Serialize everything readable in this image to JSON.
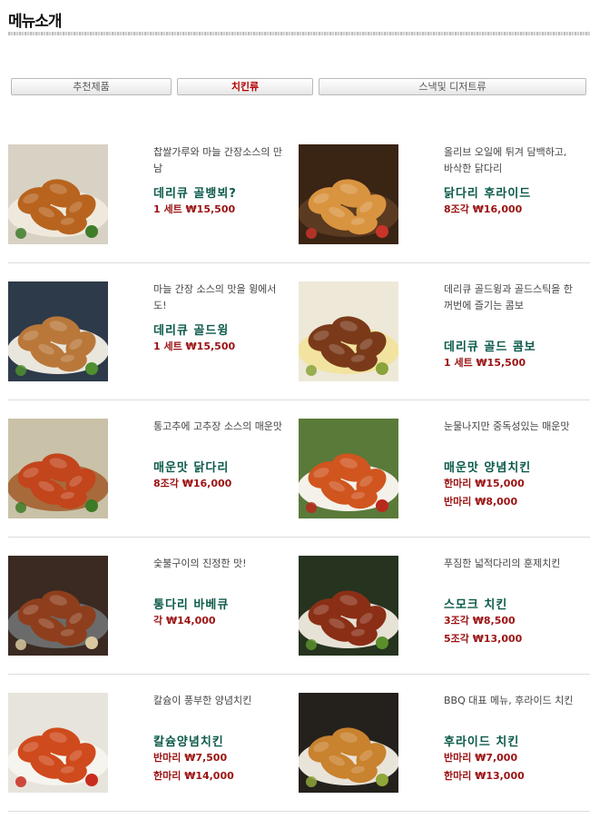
{
  "page": {
    "title": "메뉴소개"
  },
  "tabs": [
    {
      "label": "추천제품"
    },
    {
      "label": "치킨류"
    },
    {
      "label": "스낵및 디저트류"
    }
  ],
  "menu": [
    {
      "desc": "찹쌀가루와 마늘 간장소스의 만남",
      "name": "데리큐 골뱅뵈?",
      "prices": [
        "1 세트 ₩15,500"
      ]
    },
    {
      "desc": "올리브 오일에 튀겨 담백하고, 바삭한 닭다리",
      "name": "닭다리 후라이드",
      "prices": [
        "8조각 ₩16,000"
      ]
    },
    {
      "desc": "마늘 간장 소스의 맛을 윙에서도!",
      "name": "데리큐 골드윙",
      "prices": [
        "1 세트 ₩15,500"
      ]
    },
    {
      "desc": "데리큐 골드윙과 골드스틱을 한꺼번에 즐기는 콤보",
      "name": "데리큐 골드 콤보",
      "prices": [
        "1 세트 ₩15,500"
      ]
    },
    {
      "desc": "통고추에 고추장 소스의 매운맛",
      "name": "매운맛 닭다리",
      "prices": [
        "8조각 ₩16,000"
      ]
    },
    {
      "desc": "눈물나지만 중독성있는 매운맛",
      "name": "매운맛 양념치킨",
      "prices": [
        "한마리 ₩15,000",
        "반마리 ₩8,000"
      ]
    },
    {
      "desc": "숯불구이의 진정한 맛!",
      "name": "통다리 바베큐",
      "prices": [
        "각 ₩14,000"
      ]
    },
    {
      "desc": "푸짐한 넓적다리의 훈제치킨",
      "name": "스모크 치킨",
      "prices": [
        "3조각 ₩8,500",
        "5조각 ₩13,000"
      ]
    },
    {
      "desc": "칼슘이 풍부한 양념치킨",
      "name": "칼슘양념치킨",
      "prices": [
        "반마리 ₩7,500",
        "한마리 ₩14,000"
      ]
    },
    {
      "desc": "BBQ 대표 메뉴, 후라이드 치킨",
      "name": "후라이드 치킨",
      "prices": [
        "반마리 ₩7,000",
        "한마리 ₩13,000"
      ]
    }
  ],
  "images": [
    {
      "icon": "teriyaki-gold-stick-photo",
      "bg": "#d8d2c4",
      "food": "#b8641e",
      "accent": "#3f7d2b",
      "plate": "#efe9dd"
    },
    {
      "icon": "fried-drumstick-photo",
      "bg": "#3a2414",
      "food": "#d99440",
      "accent": "#c8342a",
      "plate": "#5a3a20"
    },
    {
      "icon": "teriyaki-gold-wing-photo",
      "bg": "#2d3a4a",
      "food": "#b9783a",
      "accent": "#4f8f2f",
      "plate": "#e9e6dd"
    },
    {
      "icon": "teriyaki-gold-combo-photo",
      "bg": "#eee8d8",
      "food": "#7a3a1a",
      "accent": "#8aa33a",
      "plate": "#f2e4a0"
    },
    {
      "icon": "spicy-drumstick-photo",
      "bg": "#c9c1a8",
      "food": "#c2451c",
      "accent": "#3d7a26",
      "plate": "#a86a3a"
    },
    {
      "icon": "spicy-yangnyeom-chicken-photo",
      "bg": "#5a7a3a",
      "food": "#d0551f",
      "accent": "#b92a1c",
      "plate": "#f4f1ea"
    },
    {
      "icon": "bbq-whole-leg-photo",
      "bg": "#3a2a22",
      "food": "#8e3e1c",
      "accent": "#d9c9a0",
      "plate": "#6b6b6b"
    },
    {
      "icon": "smoked-chicken-photo",
      "bg": "#26331f",
      "food": "#8a2f16",
      "accent": "#5b8f2b",
      "plate": "#e6e2d6"
    },
    {
      "icon": "calcium-yangnyeom-chicken-photo",
      "bg": "#e7e4dc",
      "food": "#cf4a1c",
      "accent": "#c82c1f",
      "plate": "#f6f4ee"
    },
    {
      "icon": "fried-chicken-photo",
      "bg": "#24211c",
      "food": "#c9822e",
      "accent": "#8fa63a",
      "plate": "#e8e4da"
    }
  ]
}
